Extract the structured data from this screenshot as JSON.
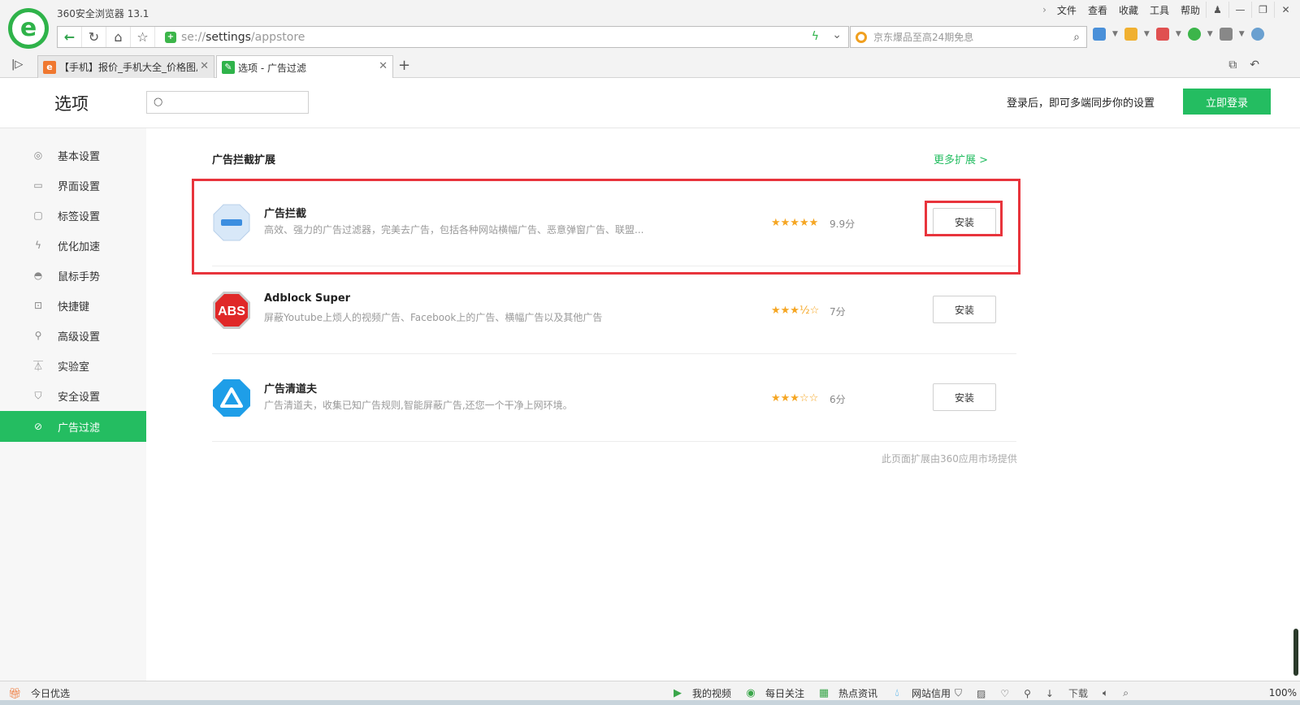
{
  "browser": {
    "title": "360安全浏览器 13.1",
    "menu": [
      "文件",
      "查看",
      "收藏",
      "工具",
      "帮助"
    ],
    "url_scheme": "se://",
    "url_host": "settings",
    "url_path": "/appstore",
    "search_placeholder": "京东爆品至高24期免息",
    "tabs": [
      {
        "label": "【手机】报价_手机大全_价格图片",
        "active": false
      },
      {
        "label": "选项 - 广告过滤",
        "active": true
      }
    ],
    "new_tab": "+"
  },
  "header": {
    "title": "选项",
    "search_placeholder": "",
    "sync_text": "登录后，即可多端同步你的设置",
    "login_label": "立即登录"
  },
  "sidebar": {
    "items": [
      {
        "label": "基本设置",
        "icon": "gear-icon"
      },
      {
        "label": "界面设置",
        "icon": "window-icon"
      },
      {
        "label": "标签设置",
        "icon": "tab-icon"
      },
      {
        "label": "优化加速",
        "icon": "lightning-icon"
      },
      {
        "label": "鼠标手势",
        "icon": "mouse-icon"
      },
      {
        "label": "快捷键",
        "icon": "keyboard-icon"
      },
      {
        "label": "高级设置",
        "icon": "wrench-icon"
      },
      {
        "label": "实验室",
        "icon": "flask-icon"
      },
      {
        "label": "安全设置",
        "icon": "shield-icon"
      },
      {
        "label": "广告过滤",
        "icon": "block-icon",
        "active": true
      }
    ]
  },
  "main": {
    "section_title": "广告拦截扩展",
    "more_link": "更多扩展 >",
    "extensions": [
      {
        "name": "广告拦截",
        "desc": "高效、强力的广告过滤器，完美去广告，包括各种网站横幅广告、恶意弹窗广告、联盟...",
        "stars": "★★★★★",
        "score": "9.9分",
        "install": "安装",
        "rating": 9.9
      },
      {
        "name": "Adblock Super",
        "desc": "屏蔽Youtube上烦人的视频广告、Facebook上的广告、横幅广告以及其他广告",
        "stars": "★★★½☆",
        "score": "7分",
        "install": "安装",
        "rating": 7
      },
      {
        "name": "广告清道夫",
        "desc": "广告清道夫，收集已知广告规则,智能屏蔽广告,还您一个干净上网环境。",
        "stars": "★★★☆☆",
        "score": "6分",
        "install": "安装",
        "rating": 6
      }
    ],
    "footer_note": "此页面扩展由360应用市场提供"
  },
  "statusbar": {
    "today": "今日优选",
    "items": [
      "我的视频",
      "每日关注",
      "热点资讯",
      "网站信用"
    ],
    "download": "下载",
    "zoom": "100%"
  },
  "colors": {
    "accent_green": "#24bd61",
    "highlight_red": "#e8343c",
    "star": "#f5a623"
  }
}
